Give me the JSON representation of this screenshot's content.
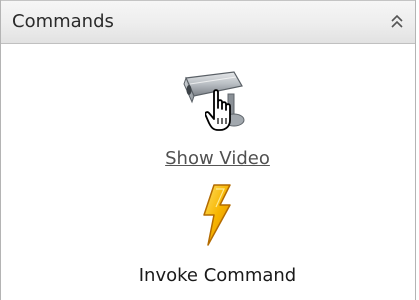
{
  "panel": {
    "title": "Commands",
    "collapse_icon": "double-chevron-up-icon"
  },
  "commands": [
    {
      "label": "Show Video",
      "icon": "security-camera-icon",
      "pointer": "hand-pointer-icon",
      "hovered": true
    },
    {
      "label": "Invoke Command",
      "icon": "lightning-bolt-icon",
      "hovered": false
    }
  ],
  "colors": {
    "header_bg": "#ececec",
    "bolt_fill": "#f5b400",
    "bolt_outline": "#c07a00",
    "camera_body": "#9aa0a6"
  }
}
